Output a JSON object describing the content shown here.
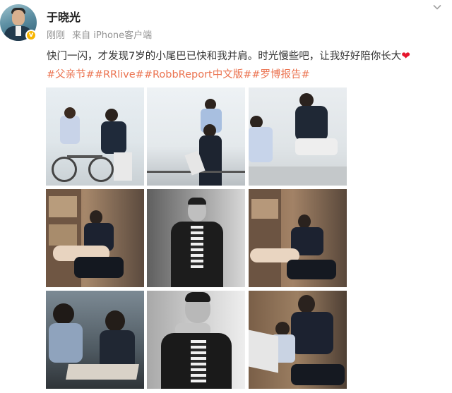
{
  "post": {
    "username": "于晓光",
    "time": "刚刚",
    "source": "来自 iPhone客户端",
    "text": "快门一闪，才发现7岁的小尾巴已快和我并肩。时光慢些吧，让我好好陪你长大",
    "hashtags": [
      "#父亲节#",
      "#RRlive#",
      "#RobbReport中文版#",
      "#罗博报告#"
    ],
    "verified_badge": "v",
    "more_icon": "chevron-down-icon"
  },
  "photos": [
    {
      "description_icon": "photo-1"
    },
    {
      "description_icon": "photo-2"
    },
    {
      "description_icon": "photo-3"
    },
    {
      "description_icon": "photo-4"
    },
    {
      "description_icon": "photo-5"
    },
    {
      "description_icon": "photo-6"
    },
    {
      "description_icon": "photo-7"
    },
    {
      "description_icon": "photo-8"
    },
    {
      "description_icon": "photo-9"
    }
  ],
  "colors": {
    "hashtag": "#eb7350",
    "text": "#333333",
    "meta": "#939393",
    "heart": "#e6162d",
    "badge": "#f7b500"
  }
}
